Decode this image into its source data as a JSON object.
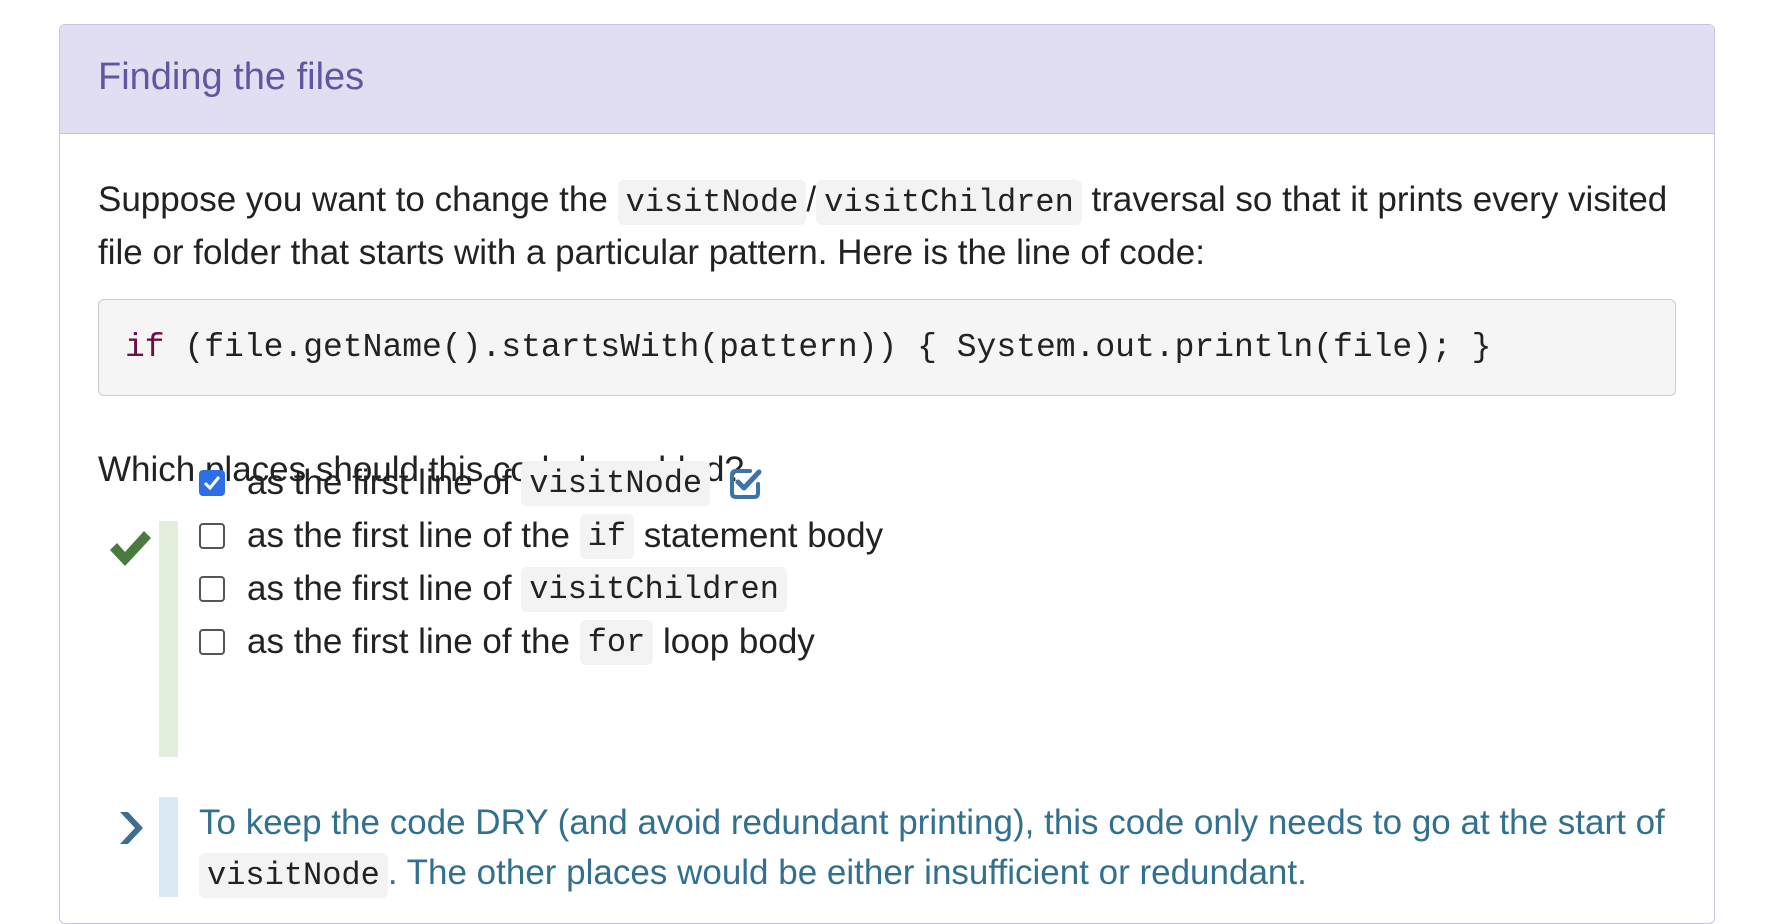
{
  "panel": {
    "title": "Finding the files"
  },
  "intro": {
    "text_1": "Suppose you want to change the ",
    "code_1": "visitNode",
    "sep": "/",
    "code_2": "visitChildren",
    "text_2": " traversal so that it prints every visited file or folder that starts with a particular pattern. Here is the line of code:"
  },
  "codeblock": {
    "keyword": "if",
    "rest": " (file.getName().startsWith(pattern)) { System.out.println(file); }"
  },
  "question": "Which places should this code be added?",
  "result_icon": "check-icon",
  "options": [
    {
      "prefix": "as the first line of ",
      "code": "visitNode",
      "suffix": "",
      "checked": true,
      "marked_correct": true
    },
    {
      "prefix": "as the first line of the ",
      "code": "if",
      "suffix": " statement body",
      "checked": false
    },
    {
      "prefix": "as the first line of ",
      "code": "visitChildren",
      "suffix": "",
      "checked": false
    },
    {
      "prefix": "as the first line of the ",
      "code": "for",
      "suffix": " loop body",
      "checked": false
    }
  ],
  "feedback": {
    "icon": "chevron-right-icon",
    "text_1": "To keep the code DRY (and avoid redundant printing), this code only needs to go at the start of ",
    "code": "visitNode",
    "text_2": ". The other places would be either insufficient or redundant."
  },
  "colors": {
    "heading_bg": "#e2def2",
    "heading_text": "#5f579f",
    "correct_green": "#4a7a3f",
    "checkbox_blue": "#2e6ee6",
    "feedback_text": "#31708f"
  }
}
